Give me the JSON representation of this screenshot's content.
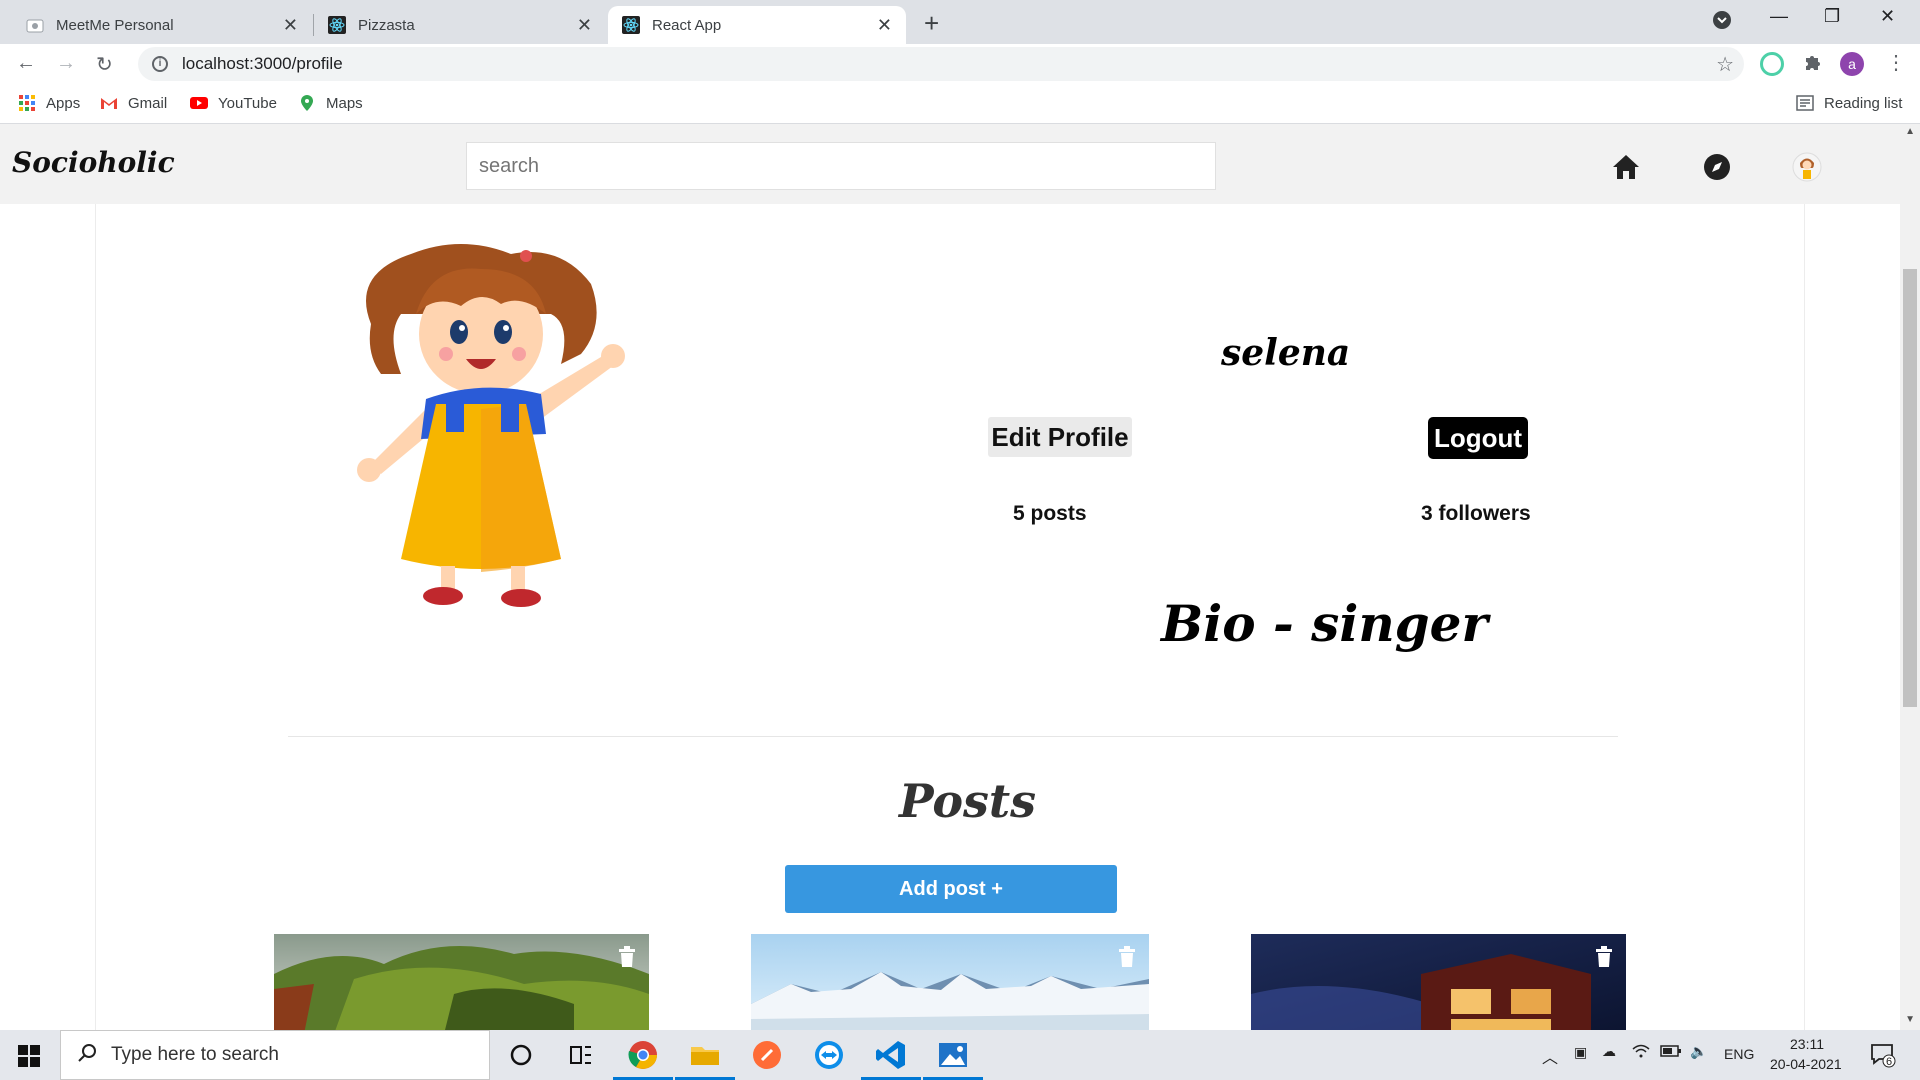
{
  "browser": {
    "tabs": [
      {
        "title": "MeetMe Personal",
        "active": false
      },
      {
        "title": "Pizzasta",
        "active": false
      },
      {
        "title": "React App",
        "active": true
      }
    ],
    "url": "localhost:3000/profile",
    "bookmarks": [
      "Apps",
      "Gmail",
      "YouTube",
      "Maps"
    ],
    "reading_list": "Reading list",
    "profile_initial": "a"
  },
  "app": {
    "brand": "Socioholic",
    "search_placeholder": "search",
    "nav_icons": [
      "home-icon",
      "compass-icon",
      "profile-avatar-icon"
    ]
  },
  "profile": {
    "username": "selena",
    "edit_label": "Edit Profile",
    "logout_label": "Logout",
    "posts": "5 posts",
    "followers": "3 followers",
    "bio": "Bio - singer"
  },
  "posts_section": {
    "heading": "Posts",
    "add_label": "Add post +",
    "thumbnails": [
      "forest-landscape",
      "snowy-mountains",
      "night-house"
    ]
  },
  "taskbar": {
    "search_placeholder": "Type here to search",
    "lang": "ENG",
    "time": "23:11",
    "date": "20-04-2021",
    "notifications": "6"
  },
  "colors": {
    "accent_blue": "#3797e0",
    "logout_bg": "#000000",
    "nav_bg": "#f2f2f2"
  }
}
